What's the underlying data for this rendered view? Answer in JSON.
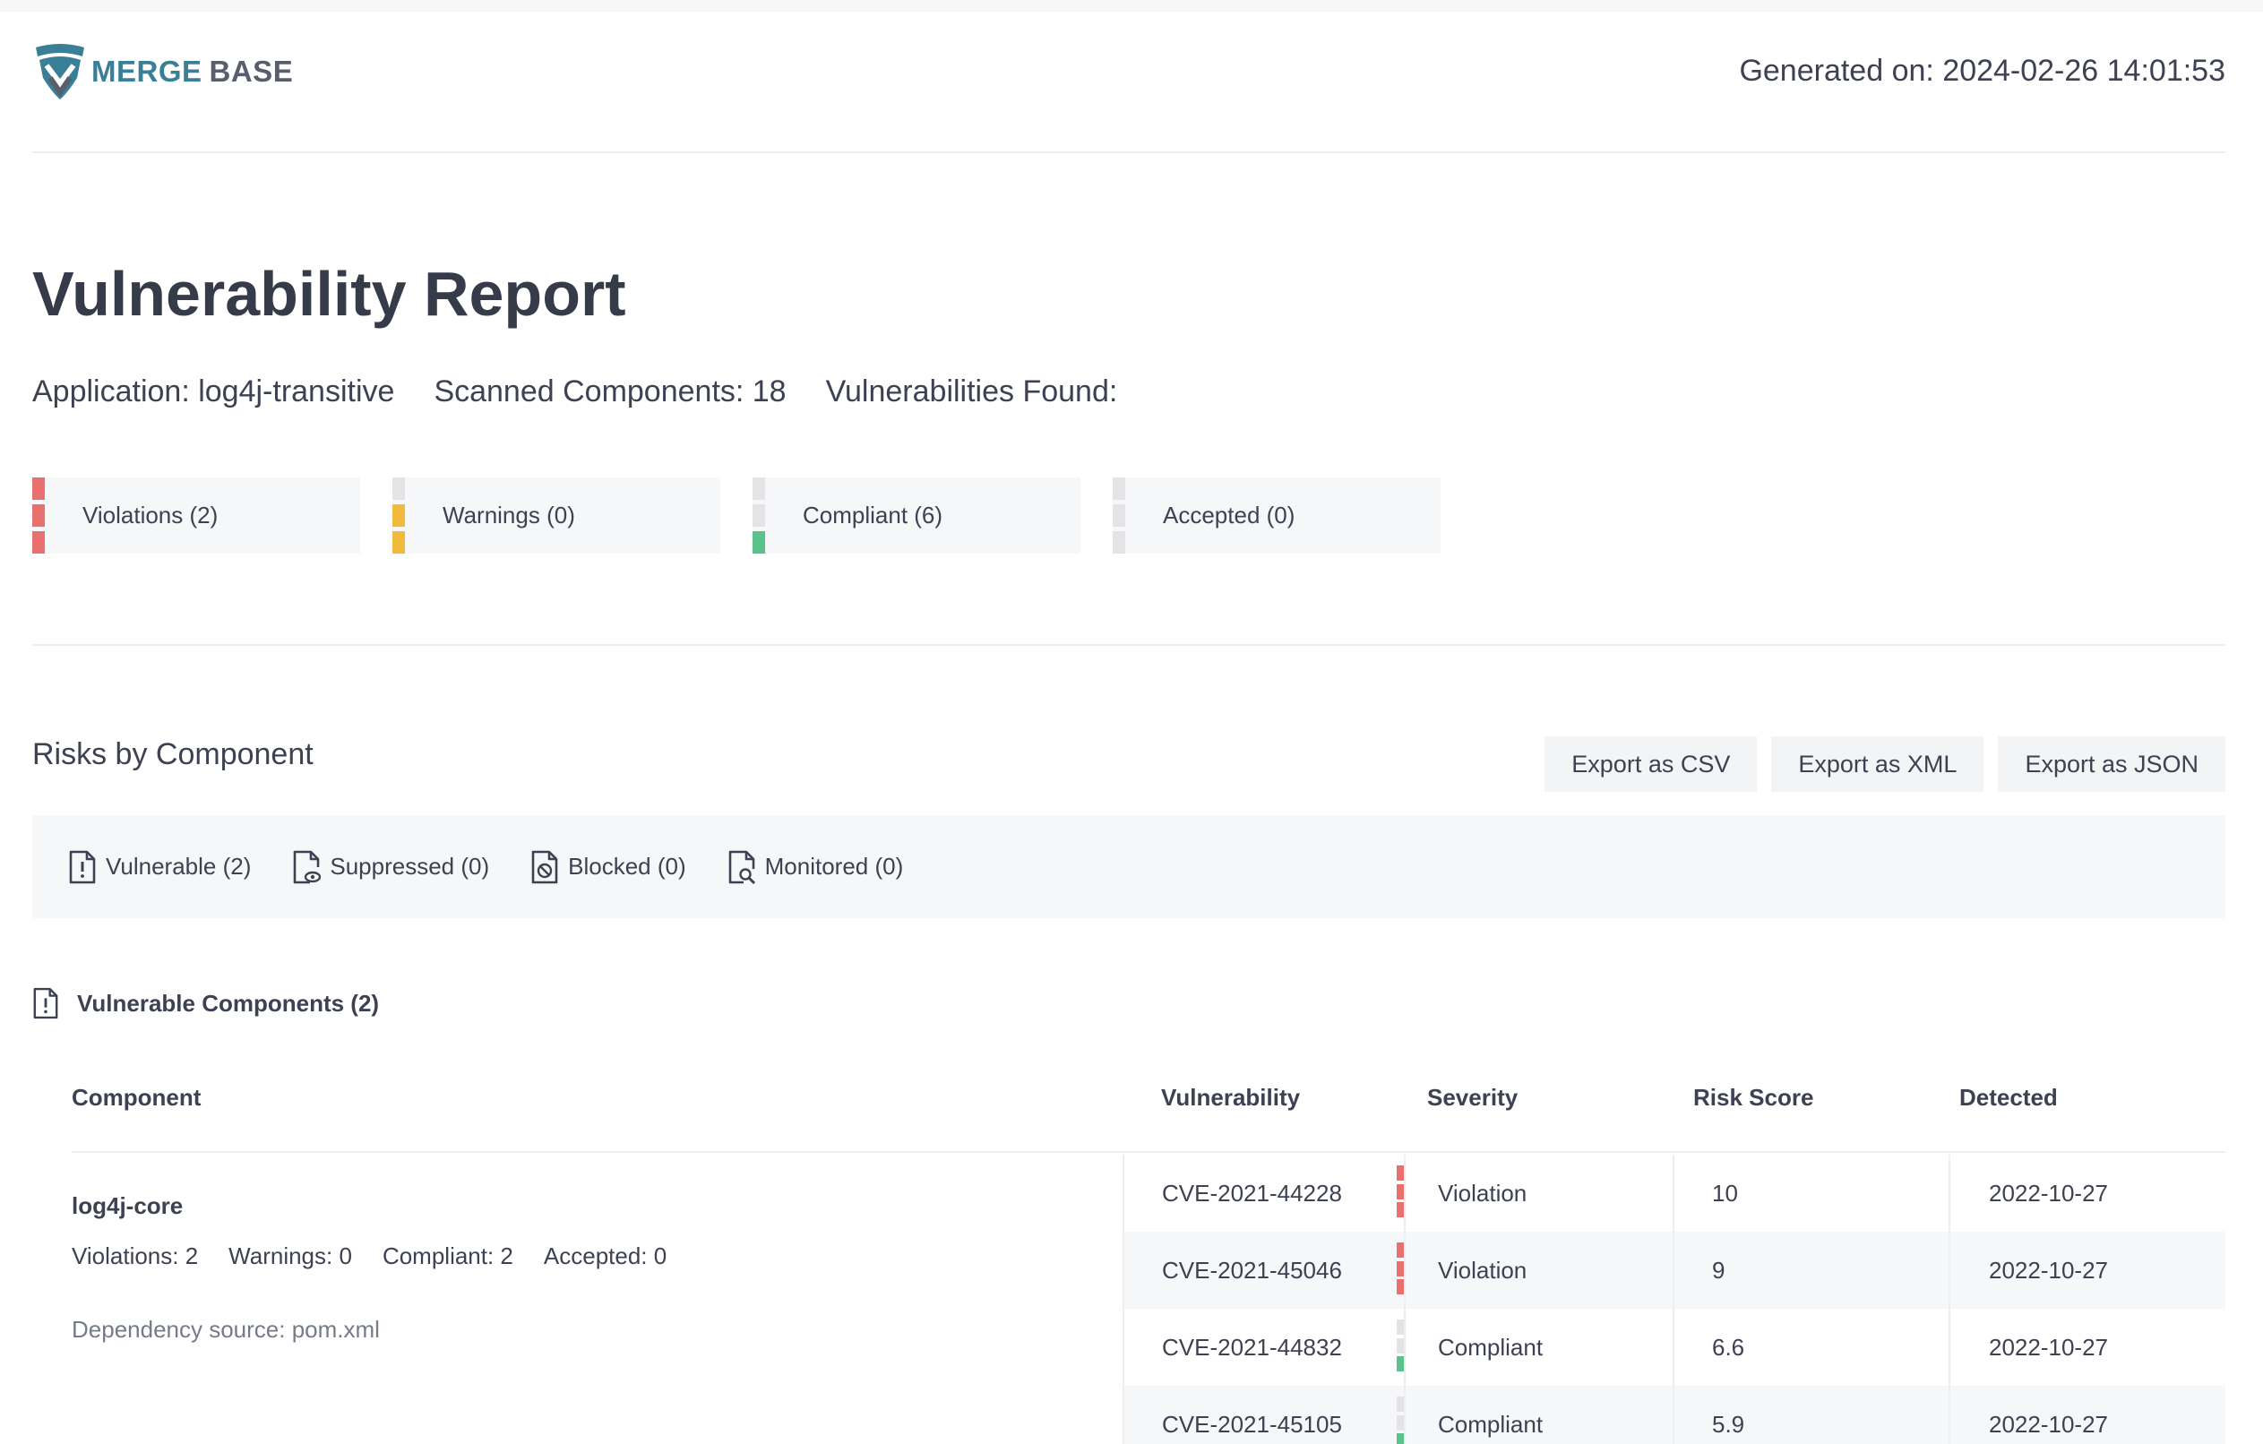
{
  "brand": {
    "name_part1": "MERGE",
    "name_part2": "BASE",
    "accent_color": "#3a7f98"
  },
  "header": {
    "generated": "Generated on: 2024-02-26 14:01:53"
  },
  "report": {
    "title": "Vulnerability Report",
    "application": "Application: log4j-transitive",
    "scanned": "Scanned Components: 18",
    "vulns_found": "Vulnerabilities Found:"
  },
  "status": [
    {
      "label": "Violations (2)",
      "color": "#e8716f",
      "level": 3
    },
    {
      "label": "Warnings (0)",
      "color": "#f0bb3c",
      "level": 2
    },
    {
      "label": "Compliant (6)",
      "color": "#5cc28c",
      "level": 1
    },
    {
      "label": "Accepted (0)",
      "color": "#e4e4e6",
      "level": 0
    }
  ],
  "risks": {
    "title": "Risks by Component",
    "export_csv": "Export as CSV",
    "export_xml": "Export as XML",
    "export_json": "Export as JSON",
    "filters": [
      {
        "label": "Vulnerable (2)",
        "icon": "file-exclamation-icon"
      },
      {
        "label": "Suppressed (0)",
        "icon": "file-eye-icon"
      },
      {
        "label": "Blocked (0)",
        "icon": "file-blocked-icon"
      },
      {
        "label": "Monitored (0)",
        "icon": "file-search-icon"
      }
    ]
  },
  "section": {
    "title": "Vulnerable Components (2)"
  },
  "table": {
    "headers": {
      "component": "Component",
      "vulnerability": "Vulnerability",
      "severity": "Severity",
      "risk": "Risk Score",
      "detected": "Detected"
    },
    "component": {
      "name": "log4j-core",
      "violations": "Violations: 2",
      "warnings": "Warnings: 0",
      "compliant": "Compliant: 2",
      "accepted": "Accepted: 0",
      "source": "Dependency source: pom.xml"
    },
    "rows": [
      {
        "cve": "CVE-2021-44228",
        "severity": "Violation",
        "risk": "10",
        "detected": "2022-10-27"
      },
      {
        "cve": "CVE-2021-45046",
        "severity": "Violation",
        "risk": "9",
        "detected": "2022-10-27"
      },
      {
        "cve": "CVE-2021-44832",
        "severity": "Compliant",
        "risk": "6.6",
        "detected": "2022-10-27"
      },
      {
        "cve": "CVE-2021-45105",
        "severity": "Compliant",
        "risk": "5.9",
        "detected": "2022-10-27"
      }
    ]
  }
}
